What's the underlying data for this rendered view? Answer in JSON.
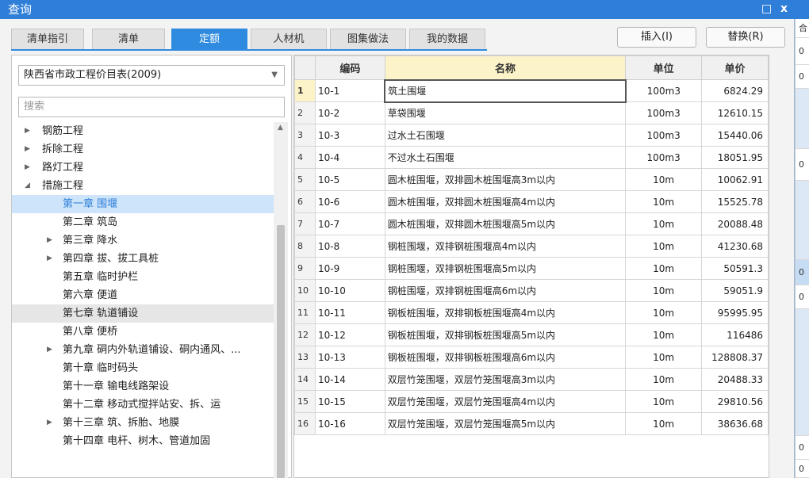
{
  "window": {
    "title": "查询",
    "restore_glyph": "□",
    "close_glyph": "x"
  },
  "tabs": [
    {
      "label": "清单指引",
      "active": false
    },
    {
      "label": "清单",
      "active": false
    },
    {
      "label": "定额",
      "active": true
    },
    {
      "label": "人材机",
      "active": false
    },
    {
      "label": "图集做法",
      "active": false
    },
    {
      "label": "我的数据",
      "active": false
    }
  ],
  "buttons": {
    "insert": "插入(I)",
    "replace": "替换(R)"
  },
  "left": {
    "library": "陕西省市政工程价目表(2009)",
    "search_placeholder": "搜索",
    "tree": [
      {
        "label": "钢筋工程",
        "level": 0,
        "toggle": "collapsed"
      },
      {
        "label": "拆除工程",
        "level": 0,
        "toggle": "collapsed"
      },
      {
        "label": "路灯工程",
        "level": 0,
        "toggle": "collapsed"
      },
      {
        "label": "措施工程",
        "level": 0,
        "toggle": "expanded"
      },
      {
        "label": "第一章 围堰",
        "level": 1,
        "toggle": "none",
        "state": "selected"
      },
      {
        "label": "第二章 筑岛",
        "level": 1,
        "toggle": "none"
      },
      {
        "label": "第三章 降水",
        "level": 1,
        "toggle": "collapsed"
      },
      {
        "label": "第四章 拔、拔工具桩",
        "level": 1,
        "toggle": "collapsed"
      },
      {
        "label": "第五章 临时护栏",
        "level": 1,
        "toggle": "none"
      },
      {
        "label": "第六章 便道",
        "level": 1,
        "toggle": "none"
      },
      {
        "label": "第七章 轨道铺设",
        "level": 1,
        "toggle": "none",
        "state": "hover"
      },
      {
        "label": "第八章 便桥",
        "level": 1,
        "toggle": "none"
      },
      {
        "label": "第九章 硐内外轨道铺设、硐内通风、...",
        "level": 1,
        "toggle": "collapsed"
      },
      {
        "label": "第十章 临时码头",
        "level": 1,
        "toggle": "none"
      },
      {
        "label": "第十一章 输电线路架设",
        "level": 1,
        "toggle": "none"
      },
      {
        "label": "第十二章 移动式搅拌站安、拆、运",
        "level": 1,
        "toggle": "none"
      },
      {
        "label": "第十三章 筑、拆胎、地膜",
        "level": 1,
        "toggle": "collapsed"
      },
      {
        "label": "第十四章 电杆、树木、管道加固",
        "level": 1,
        "toggle": "none"
      }
    ]
  },
  "grid": {
    "headers": {
      "code": "编码",
      "name": "名称",
      "unit": "单位",
      "price": "单价"
    },
    "rows": [
      {
        "no": "1",
        "code": "10-1",
        "name": "筑土围堰",
        "unit": "100m3",
        "price": "6824.29"
      },
      {
        "no": "2",
        "code": "10-2",
        "name": "草袋围堰",
        "unit": "100m3",
        "price": "12610.15"
      },
      {
        "no": "3",
        "code": "10-3",
        "name": "过水土石围堰",
        "unit": "100m3",
        "price": "15440.06"
      },
      {
        "no": "4",
        "code": "10-4",
        "name": "不过水土石围堰",
        "unit": "100m3",
        "price": "18051.95"
      },
      {
        "no": "5",
        "code": "10-5",
        "name": "圆木桩围堰，双排圆木桩围堰高3m以内",
        "unit": "10m",
        "price": "10062.91"
      },
      {
        "no": "6",
        "code": "10-6",
        "name": "圆木桩围堰，双排圆木桩围堰高4m以内",
        "unit": "10m",
        "price": "15525.78"
      },
      {
        "no": "7",
        "code": "10-7",
        "name": "圆木桩围堰，双排圆木桩围堰高5m以内",
        "unit": "10m",
        "price": "20088.48"
      },
      {
        "no": "8",
        "code": "10-8",
        "name": "钢桩围堰，双排钢桩围堰高4m以内",
        "unit": "10m",
        "price": "41230.68"
      },
      {
        "no": "9",
        "code": "10-9",
        "name": "钢桩围堰，双排钢桩围堰高5m以内",
        "unit": "10m",
        "price": "50591.3"
      },
      {
        "no": "10",
        "code": "10-10",
        "name": "钢桩围堰，双排钢桩围堰高6m以内",
        "unit": "10m",
        "price": "59051.9"
      },
      {
        "no": "11",
        "code": "10-11",
        "name": "钢板桩围堰，双排钢板桩围堰高4m以内",
        "unit": "10m",
        "price": "95995.95"
      },
      {
        "no": "12",
        "code": "10-12",
        "name": "钢板桩围堰，双排钢板桩围堰高5m以内",
        "unit": "10m",
        "price": "116486"
      },
      {
        "no": "13",
        "code": "10-13",
        "name": "钢板桩围堰，双排钢板桩围堰高6m以内",
        "unit": "10m",
        "price": "128808.37"
      },
      {
        "no": "14",
        "code": "10-14",
        "name": "双层竹笼围堰，双层竹笼围堰高3m以内",
        "unit": "10m",
        "price": "20488.33"
      },
      {
        "no": "15",
        "code": "10-15",
        "name": "双层竹笼围堰，双层竹笼围堰高4m以内",
        "unit": "10m",
        "price": "29810.56"
      },
      {
        "no": "16",
        "code": "10-16",
        "name": "双层竹笼围堰，双层竹笼围堰高5m以内",
        "unit": "10m",
        "price": "38636.68"
      }
    ]
  },
  "right_strip": [
    "合",
    "0",
    "0",
    "0",
    "0",
    "0",
    "0",
    "0"
  ]
}
